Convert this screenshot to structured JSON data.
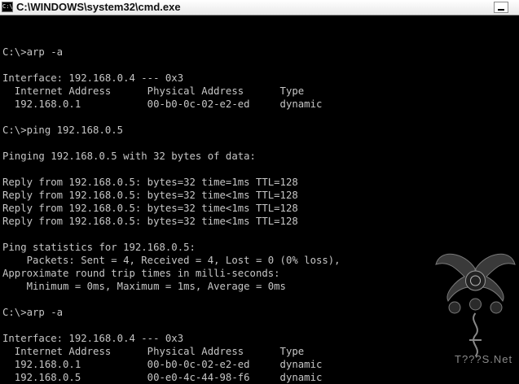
{
  "window": {
    "title": "C:\\WINDOWS\\system32\\cmd.exe",
    "icon_text": "C:\\"
  },
  "console": {
    "lines": [
      "",
      "C:\\>arp -a",
      "",
      "Interface: 192.168.0.4 --- 0x3",
      "  Internet Address      Physical Address      Type",
      "  192.168.0.1           00-b0-0c-02-e2-ed     dynamic",
      "",
      "C:\\>ping 192.168.0.5",
      "",
      "Pinging 192.168.0.5 with 32 bytes of data:",
      "",
      "Reply from 192.168.0.5: bytes=32 time=1ms TTL=128",
      "Reply from 192.168.0.5: bytes=32 time<1ms TTL=128",
      "Reply from 192.168.0.5: bytes=32 time<1ms TTL=128",
      "Reply from 192.168.0.5: bytes=32 time<1ms TTL=128",
      "",
      "Ping statistics for 192.168.0.5:",
      "    Packets: Sent = 4, Received = 4, Lost = 0 (0% loss),",
      "Approximate round trip times in milli-seconds:",
      "    Minimum = 0ms, Maximum = 1ms, Average = 0ms",
      "",
      "C:\\>arp -a",
      "",
      "Interface: 192.168.0.4 --- 0x3",
      "  Internet Address      Physical Address      Type",
      "  192.168.0.1           00-b0-0c-02-e2-ed     dynamic",
      "  192.168.0.5           00-e0-4c-44-98-f6     dynamic"
    ]
  },
  "watermark": {
    "text": "T???S.Net"
  }
}
